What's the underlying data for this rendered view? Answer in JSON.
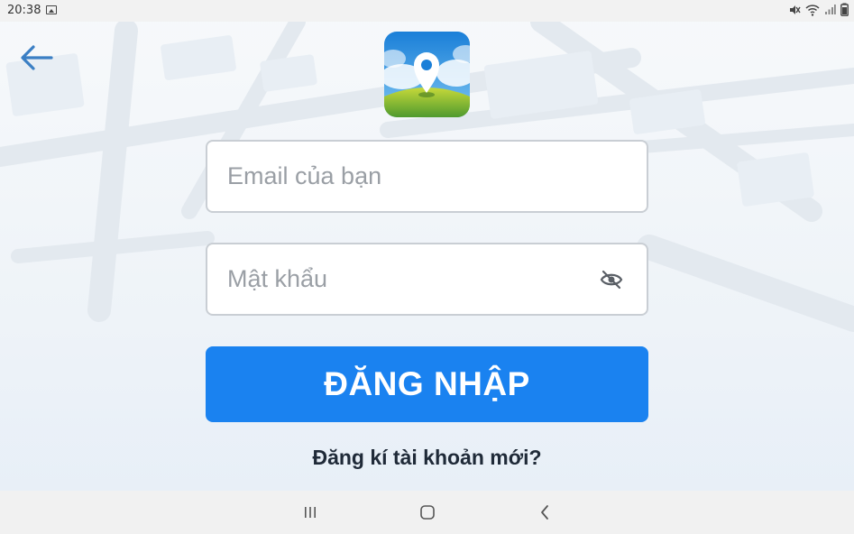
{
  "status_bar": {
    "time": "20:38",
    "icons": [
      "image-icon",
      "mute-icon",
      "wifi-icon",
      "signal-icon",
      "battery-icon"
    ]
  },
  "header": {
    "back_icon": "arrow-left-icon",
    "logo_icon": "map-pin-landscape-logo"
  },
  "form": {
    "email": {
      "value": "",
      "placeholder": "Email của bạn"
    },
    "password": {
      "value": "",
      "placeholder": "Mật khẩu",
      "toggle_icon": "eye-off-icon"
    },
    "login_label": "ĐĂNG NHẬP",
    "register_label": "Đăng kí tài khoản mới?"
  },
  "nav_bar": {
    "icons": [
      "recent-apps-icon",
      "home-icon",
      "back-chevron-icon"
    ]
  },
  "colors": {
    "primary": "#1a82f0",
    "input_border": "#c9ced4",
    "placeholder": "#9a9fa5",
    "back_arrow": "#3b7fc4",
    "register_text": "#1f2a38"
  }
}
